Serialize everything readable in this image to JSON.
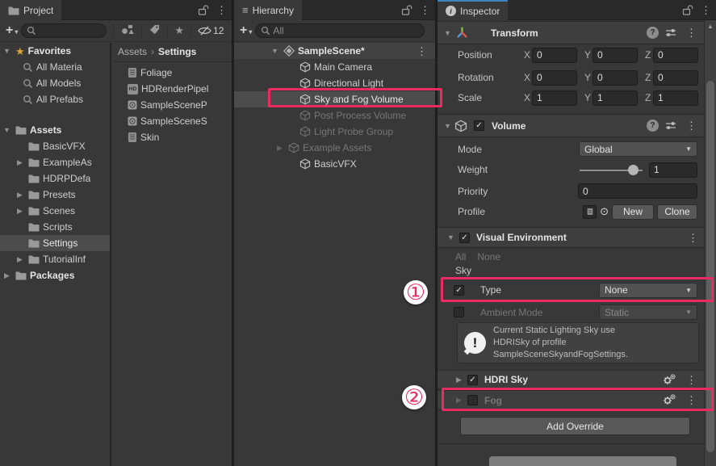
{
  "icons": {
    "caret_down": "▼",
    "caret_right": "▶",
    "kebab": "⋮",
    "check": "✓",
    "star": "★",
    "plus": "+",
    "small_arrow": "▾",
    "dropdown_arrow": "▼",
    "picker": "⊙",
    "chevron": "›",
    "scroll_up": "▲",
    "info": "i",
    "help": "?",
    "exclaim": "!",
    "menu": "≡"
  },
  "project": {
    "tab_label": "Project",
    "hidden_count": "12",
    "tree": [
      {
        "label": "Favorites"
      },
      {
        "label": "All Materia"
      },
      {
        "label": "All Models"
      },
      {
        "label": "All Prefabs"
      },
      {
        "label": "Assets"
      },
      {
        "label": "BasicVFX"
      },
      {
        "label": "ExampleAs"
      },
      {
        "label": "HDRPDefa"
      },
      {
        "label": "Presets"
      },
      {
        "label": "Scenes"
      },
      {
        "label": "Scripts"
      },
      {
        "label": "Settings"
      },
      {
        "label": "TutorialInf"
      },
      {
        "label": "Packages"
      }
    ],
    "breadcrumb": {
      "root": "Assets",
      "current": "Settings"
    },
    "files": [
      {
        "label": "Foliage"
      },
      {
        "label": "HDRenderPipel",
        "badge": "HD"
      },
      {
        "label": "SampleSceneP"
      },
      {
        "label": "SampleSceneS"
      },
      {
        "label": "Skin"
      }
    ]
  },
  "hierarchy": {
    "tab_label": "Hierarchy",
    "search_placeholder": "All",
    "scene_label": "SampleScene*",
    "items": [
      {
        "label": "Main Camera"
      },
      {
        "label": "Directional Light"
      },
      {
        "label": "Sky and Fog Volume"
      },
      {
        "label": "Post Process Volume"
      },
      {
        "label": "Light Probe Group"
      },
      {
        "label": "Example Assets"
      },
      {
        "label": "BasicVFX"
      }
    ]
  },
  "inspector": {
    "tab_label": "Inspector",
    "transform": {
      "title": "Transform",
      "axis_x": "X",
      "axis_y": "Y",
      "axis_z": "Z",
      "rows": [
        {
          "label": "Position",
          "x": "0",
          "y": "0",
          "z": "0"
        },
        {
          "label": "Rotation",
          "x": "0",
          "y": "0",
          "z": "0"
        },
        {
          "label": "Scale",
          "x": "1",
          "y": "1",
          "z": "1"
        }
      ]
    },
    "volume": {
      "title": "Volume",
      "mode_label": "Mode",
      "mode_value": "Global",
      "weight_label": "Weight",
      "weight_value": "1",
      "priority_label": "Priority",
      "priority_value": "0",
      "profile_label": "Profile",
      "new_label": "New",
      "clone_label": "Clone"
    },
    "visual_environment": {
      "title": "Visual Environment",
      "filter_all": "All",
      "filter_none": "None",
      "section_label": "Sky",
      "type_label": "Type",
      "type_value": "None",
      "ambient_label": "Ambient Mode",
      "ambient_value": "Static",
      "helpbox_text": "Current Static Lighting Sky use HDRISky of profile SampleSceneSkyandFogSettings."
    },
    "overrides": [
      {
        "label": "HDRI Sky"
      },
      {
        "label": "Fog"
      }
    ],
    "add_override_label": "Add Override"
  },
  "annotations": {
    "badge_one": "①",
    "badge_two": "②",
    "highlight_color": "#ea2b63"
  }
}
